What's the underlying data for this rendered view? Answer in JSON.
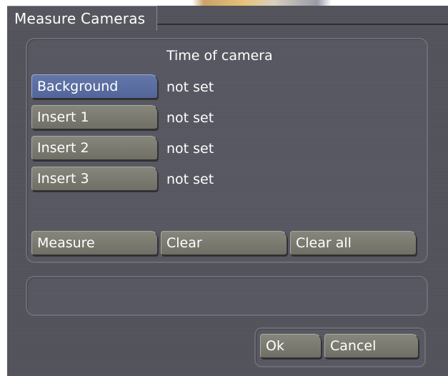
{
  "window": {
    "title": "Measure Cameras"
  },
  "table": {
    "column_header": "Time of camera",
    "rows": [
      {
        "button_label": "Background",
        "value": "not set",
        "selected": true
      },
      {
        "button_label": "Insert 1",
        "value": "not set",
        "selected": false
      },
      {
        "button_label": "Insert 2",
        "value": "not set",
        "selected": false
      },
      {
        "button_label": "Insert 3",
        "value": "not set",
        "selected": false
      }
    ]
  },
  "actions": {
    "measure_label": "Measure",
    "clear_label": "Clear",
    "clear_all_label": "Clear all"
  },
  "status": {
    "text": ""
  },
  "dialog_buttons": {
    "ok_label": "Ok",
    "cancel_label": "Cancel"
  },
  "colors": {
    "background": "#52525a",
    "button": "#7a7a70",
    "selected_button": "#5a6ea3",
    "text": "#ffffff"
  }
}
